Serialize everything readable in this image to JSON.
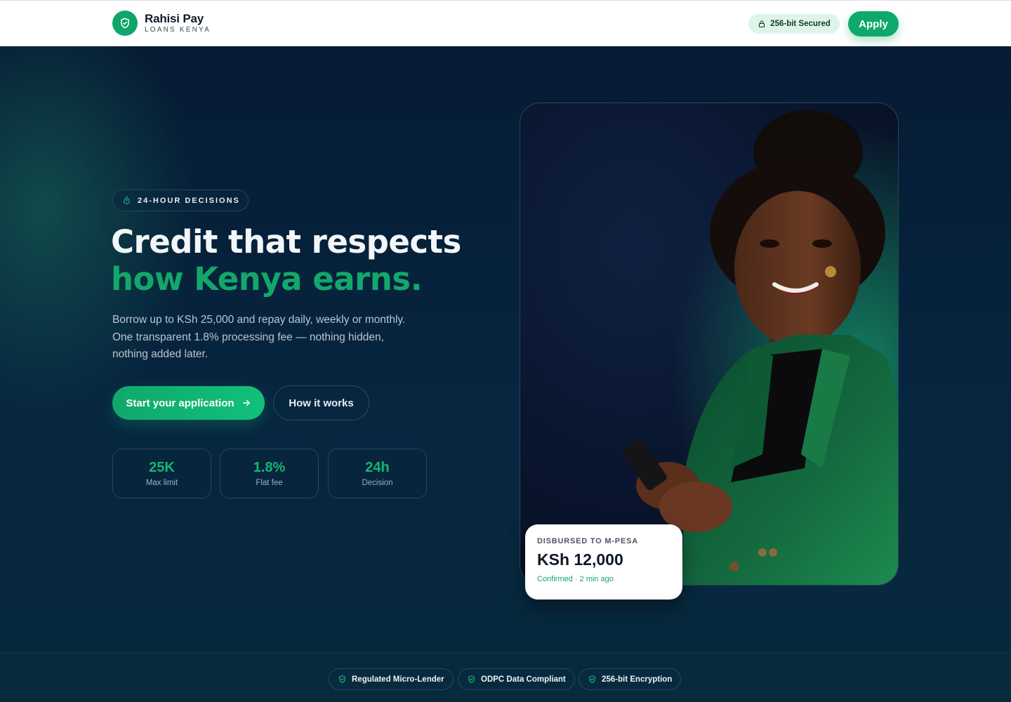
{
  "header": {
    "brand_name": "Rahisi Pay",
    "brand_sub": "LOANS KENYA",
    "logo_icon": "shield-check-icon",
    "secured_label": "256-bit Secured",
    "apply_label": "Apply"
  },
  "hero": {
    "badge": "24-HOUR DECISIONS",
    "headline_line1": "Credit that respects",
    "headline_line2": "how Kenya earns.",
    "lead": "Borrow up to KSh 25,000 and repay daily, weekly or monthly. One transparent 1.8% processing fee — nothing hidden, nothing added later.",
    "cta_primary": "Start your application",
    "cta_secondary": "How it works",
    "stats": [
      {
        "value": "25K",
        "label": "Max limit"
      },
      {
        "value": "1.8%",
        "label": "Flat fee"
      },
      {
        "value": "24h",
        "label": "Decision"
      }
    ]
  },
  "disbursement": {
    "title": "DISBURSED TO M-PESA",
    "amount": "KSh 12,000",
    "status": "Confirmed · 2 min ago"
  },
  "trust": [
    {
      "label": "Regulated Micro-Lender",
      "icon": "shield-check-icon"
    },
    {
      "label": "ODPC Data Compliant",
      "icon": "shield-check-icon"
    },
    {
      "label": "256-bit Encryption",
      "icon": "shield-check-icon"
    }
  ],
  "colors": {
    "accent": "#10a56a",
    "background": "#062238",
    "headline_accent": "#12a86b"
  }
}
